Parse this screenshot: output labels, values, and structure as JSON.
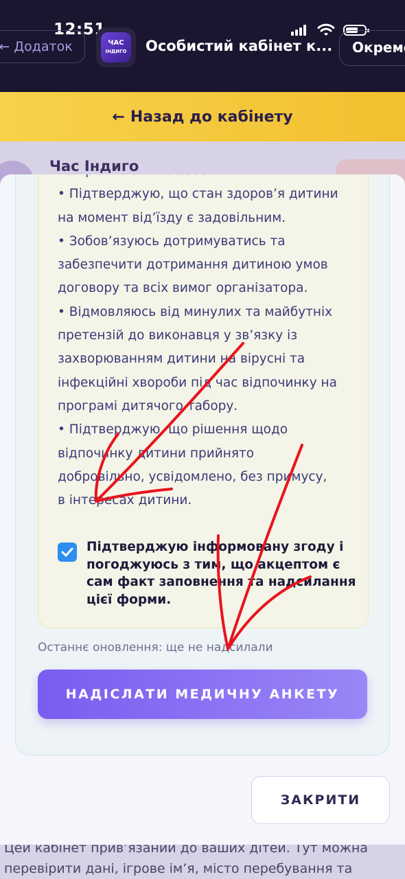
{
  "status_bar": {
    "time": "12:51"
  },
  "app_bar": {
    "back_label": "Додаток",
    "logo_text_top": "ЧАС",
    "logo_text_bottom": "ІНДИГО",
    "title": "Особистий кабінет к...",
    "separate_label": "Окремо"
  },
  "page": {
    "back_to_cabinet": "Назад до кабінету",
    "card_title": "Час Індиго",
    "bottom_text_line1": "Цей кабінет прив’язаний до ваших дітей. Тут можна",
    "bottom_text_line2": "перевірити дані, ігрове ім’я, місто перебування та"
  },
  "modal": {
    "consent_lines": [
      "та приймаю їх на себе.",
      "• Підтверджую, що стан здоров’я дитини",
      "на момент від’їзду є задовільним.",
      "• Зобов’язуюсь дотримуватись та",
      "забезпечити дотримання дитиною умов",
      "договору та всіх вимог організатора.",
      "• Відмовляюсь від минулих та майбутніх",
      "претензій до виконавця у зв’язку із",
      "захворюванням дитини на вірусні та",
      "інфекційні хвороби під час відпочинку на",
      "програмі дитячого табору.",
      "• Підтверджую, що рішення щодо",
      "відпочинку дитини прийнято",
      "добровільно, усвідомлено, без примусу,",
      "в інтересах дитини."
    ],
    "agree_checked": true,
    "agree_text": "Підтверджую інформовану згоду і погоджуюсь з тим, що акцептом є сам факт заповнення та надсилання цієї форми.",
    "last_update": "Останнє оновлення: ще не надсилали",
    "submit_label": "НАДІСЛАТИ МЕДИЧНУ АНКЕТУ",
    "close_label": "ЗАКРИТИ"
  },
  "colors": {
    "accent": "#7a5cf0",
    "checkbox": "#2b8ef0",
    "annotation": "#e8141c"
  }
}
